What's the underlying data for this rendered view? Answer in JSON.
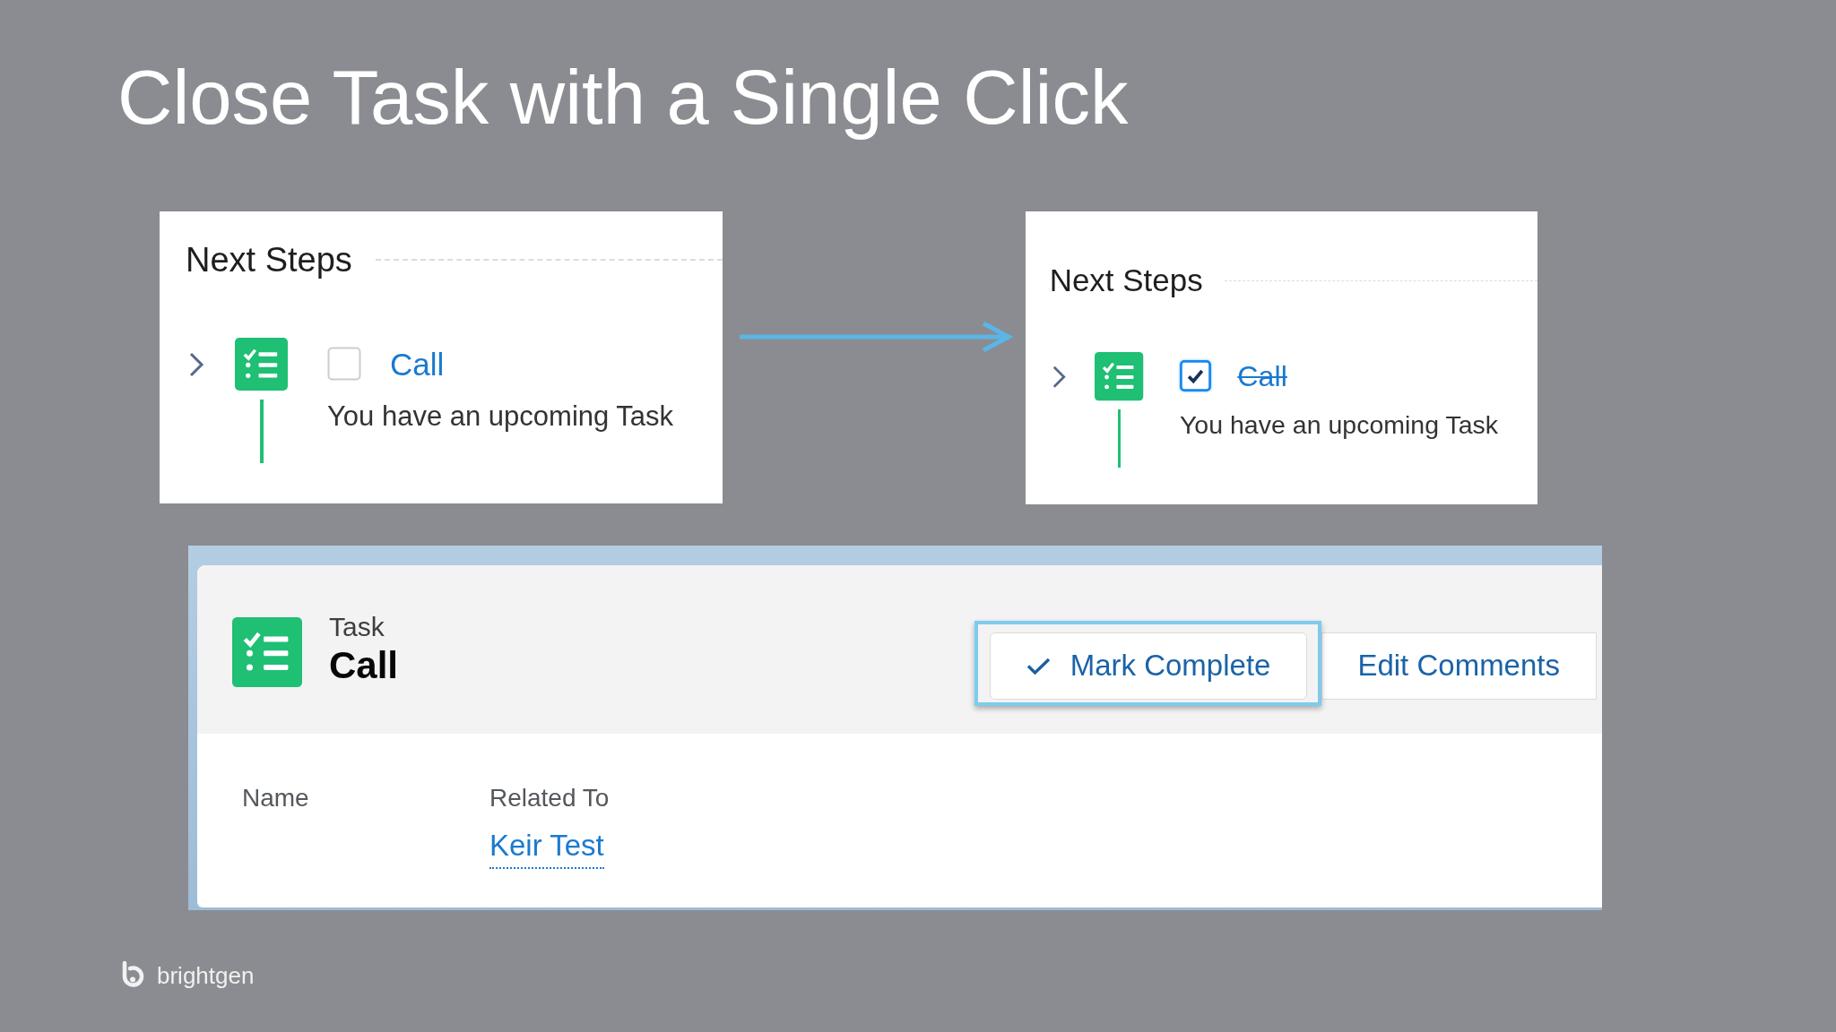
{
  "slide": {
    "title": "Close Task with a Single Click"
  },
  "panels": [
    {
      "heading": "Next Steps",
      "task": {
        "expanded": false,
        "checked": false,
        "title": "Call",
        "description": "You have an upcoming Task"
      }
    },
    {
      "heading": "Next Steps",
      "task": {
        "expanded": false,
        "checked": true,
        "title": "Call",
        "description": "You have an upcoming Task"
      }
    }
  ],
  "task_record": {
    "object_label": "Task",
    "title": "Call",
    "actions": [
      {
        "kind": "iconed",
        "label": "Mark Complete",
        "highlighted": true
      },
      {
        "kind": "plain",
        "label": "Edit Comments",
        "highlighted": false
      }
    ],
    "fields": [
      {
        "label": "Name"
      },
      {
        "label": "Related To",
        "value": "Keir Test"
      }
    ]
  },
  "footer": {
    "brand": "brightgen"
  }
}
